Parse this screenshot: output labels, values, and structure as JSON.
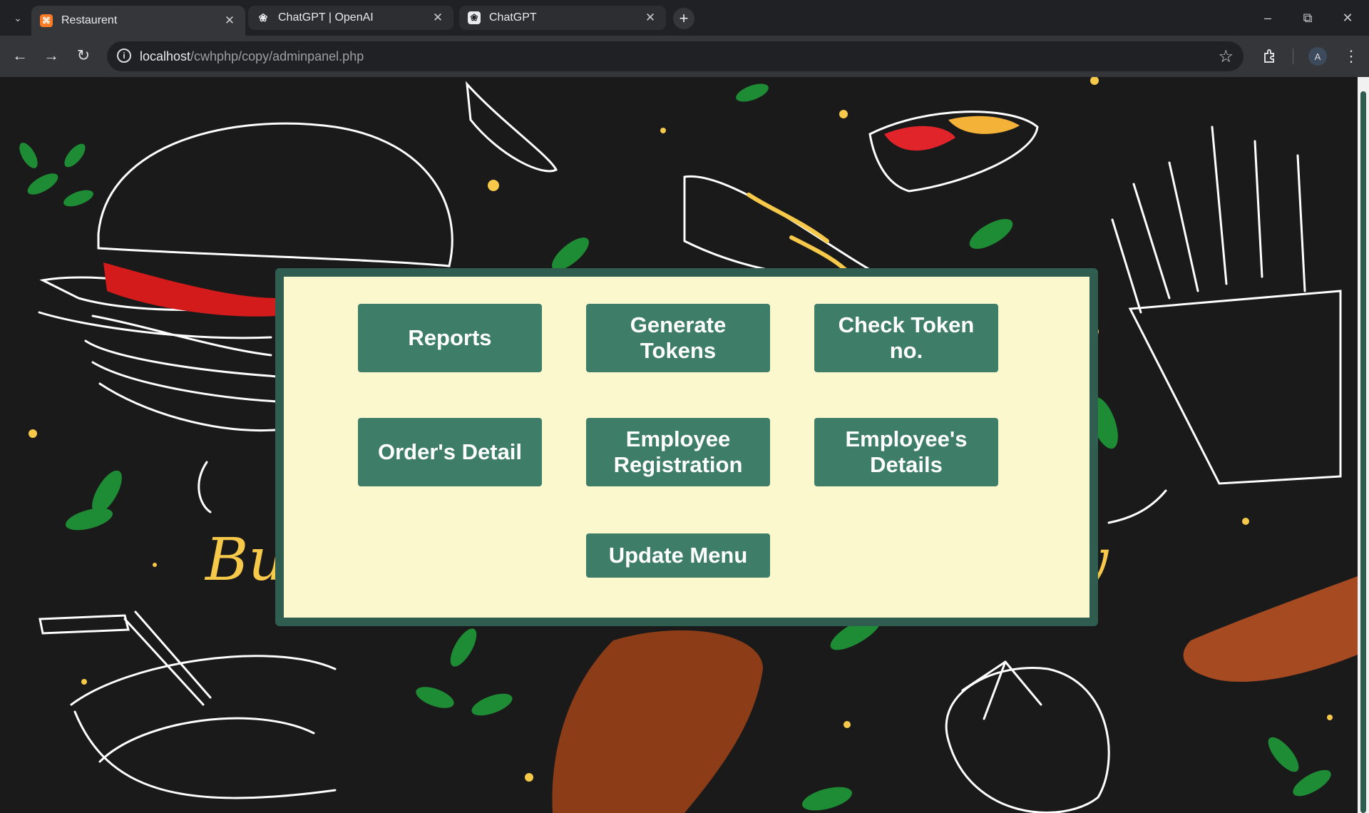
{
  "browser": {
    "tabs": [
      {
        "title": "Restaurent",
        "icon": "xampp-icon",
        "active": true
      },
      {
        "title": "ChatGPT | OpenAI",
        "icon": "openai-icon",
        "active": false
      },
      {
        "title": "ChatGPT",
        "icon": "openai-icon",
        "active": false
      }
    ],
    "url_host": "localhost",
    "url_path": "/cwhphp/copy/adminpanel.php",
    "profile_initial": "A"
  },
  "page": {
    "background_text_left": "Bu",
    "background_text_right": "y",
    "buttons": {
      "reports": "Reports",
      "generate_tokens": "Generate Tokens",
      "check_token": "Check Token no.",
      "orders_detail": "Order's Detail",
      "employee_registration": "Employee Registration",
      "employees_details": "Employee's Details",
      "update_menu": "Update Menu"
    }
  },
  "colors": {
    "panel_bg": "#fcf8cd",
    "panel_border": "#2f5d4f",
    "button_bg": "#3e7d68",
    "page_bg": "#1a1a1a"
  }
}
